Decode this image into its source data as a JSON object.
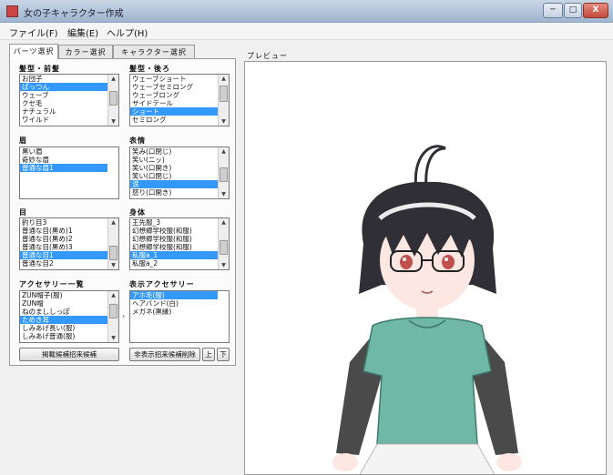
{
  "window": {
    "title": "女の子キャラクター作成",
    "min_label": "─",
    "max_label": "□",
    "close_label": "X"
  },
  "menu": [
    {
      "label": "ファイル(F)"
    },
    {
      "label": "編集(E)"
    },
    {
      "label": "ヘルプ(H)"
    }
  ],
  "tabs": [
    {
      "label": "パーツ選択"
    },
    {
      "label": "カラー選択"
    },
    {
      "label": "キャラクター選択"
    }
  ],
  "groups": {
    "hair_front": {
      "label": "髪型・前髪",
      "items": [
        "お団子",
        "ぱっつん",
        "ウェーブ",
        "クセ毛",
        "ナチュラル",
        "ワイルド"
      ],
      "selected": 1
    },
    "hair_back": {
      "label": "髪型・後ろ",
      "items": [
        "ウェーブショート",
        "ウェーブセミロング",
        "ウェーブロング",
        "サイドテール",
        "ショート",
        "セミロング"
      ],
      "selected": 4
    },
    "eyebrow": {
      "label": "眉",
      "items": [
        "黒い眉",
        "奇妙な眉",
        "普通な眉1"
      ],
      "selected": 2
    },
    "expression": {
      "label": "表情",
      "items": [
        "笑み(口閉じ)",
        "笑い(ニッ)",
        "笑い(口開き)",
        "笑い(口閉じ)",
        "涙",
        "怒り(口開き)"
      ],
      "selected": 4
    },
    "eyes": {
      "label": "目",
      "items": [
        "釣り目3",
        "普通な目(黒め)1",
        "普通な目(黒め)2",
        "普通な目(黒め)3",
        "普通な目1",
        "普通な目2"
      ],
      "selected": 4
    },
    "body": {
      "label": "身体",
      "items": [
        "王先服_3",
        "幻想郷学校服(和服)",
        "幻想郷学校服(和服)",
        "幻想郷学校服(和服)",
        "私服a_1",
        "私服a_2"
      ],
      "selected": 4
    },
    "accessory_list": {
      "label": "アクセサリー一覧",
      "items": [
        "ZUN帽子(服)",
        "ZUN帽",
        "ねのまししっぽ",
        "ためき耳",
        "しみあげ長い(服)",
        "しみあげ普通(服)"
      ],
      "selected": 3
    },
    "accessory_shown": {
      "label": "表示アクセサリー",
      "items": [
        "アホ毛(服)",
        "ヘアバンド(白)",
        "メガネ(黒縁)"
      ],
      "selected": 0
    }
  },
  "buttons": {
    "add_accessory": "掲載候補招来候補",
    "remove_accessory": "非表示招来候補削除",
    "up": "上",
    "down": "下"
  },
  "preview": {
    "label": "プレビュー"
  },
  "colors": {
    "selection": "#3399ff",
    "shirt": "#6fb8a6",
    "sleeve": "#4a4a4a",
    "hair": "#2f2f35"
  }
}
